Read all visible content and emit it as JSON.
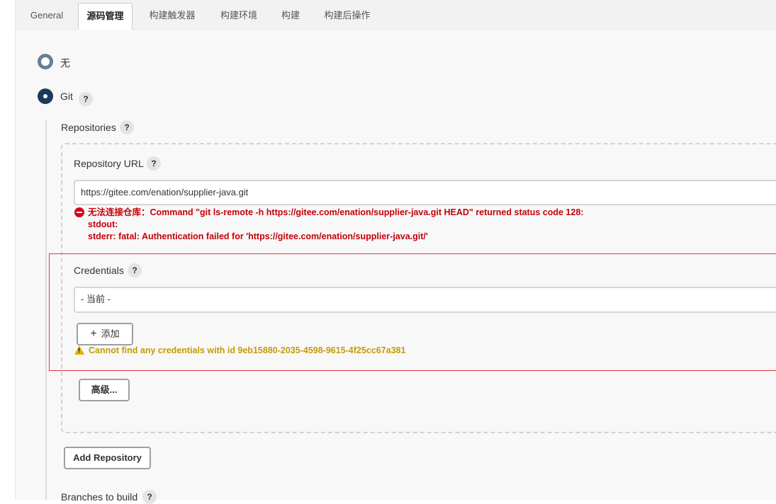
{
  "tabs": [
    "General",
    "源码管理",
    "构建触发器",
    "构建环境",
    "构建",
    "构建后操作"
  ],
  "scm": {
    "none_label": "无",
    "git_label": "Git",
    "help_mark": "?"
  },
  "repositories": {
    "label": "Repositories",
    "url_label": "Repository URL",
    "url_value": "https://gitee.com/enation/supplier-java.git",
    "error_line1": "无法连接仓库：Command \"git ls-remote -h https://gitee.com/enation/supplier-java.git HEAD\" returned status code 128:",
    "error_line2": "stdout:",
    "error_line3": "stderr: fatal: Authentication failed for 'https://gitee.com/enation/supplier-java.git/'",
    "credentials_label": "Credentials",
    "credentials_value": "- 当前 -",
    "add_button_icon": "+",
    "add_button_label": "添加",
    "warning_text": "Cannot find any credentials with id 9eb15880-2035-4598-9615-4f25cc67a381",
    "advanced_button": "高级...",
    "add_repository_button": "Add Repository"
  },
  "branches": {
    "label": "Branches to build"
  },
  "colors": {
    "error": "#c4000a",
    "warning": "#c59b00",
    "highlight_border": "#e0383e",
    "radio_selected": "#1a3a5c"
  }
}
